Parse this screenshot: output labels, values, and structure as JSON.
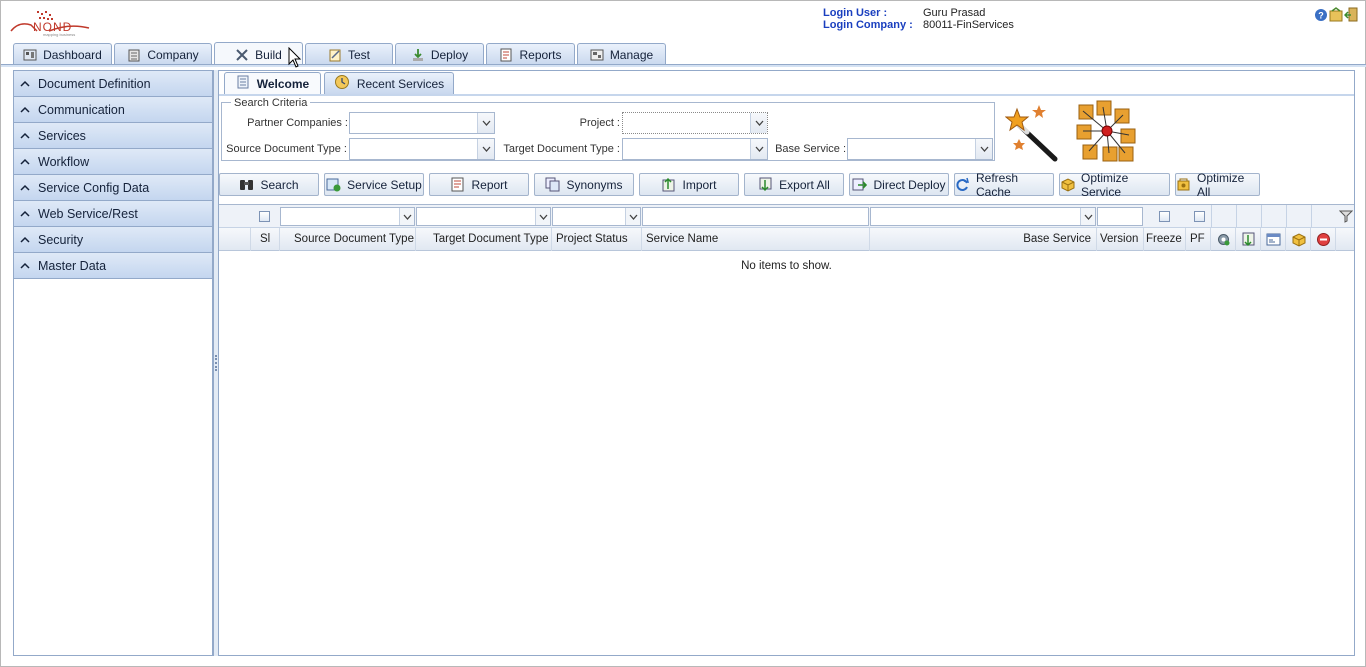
{
  "header": {
    "logo_text": "NOND",
    "logo_tagline": "mapping business",
    "login_user_label": "Login User :",
    "login_user_value": "Guru Prasad",
    "login_company_label": "Login Company :",
    "login_company_value": "80011-FinServices",
    "icons": [
      "help-icon",
      "user-settings-icon",
      "logout-icon"
    ]
  },
  "main_tabs": [
    {
      "label": "Dashboard",
      "icon": "dashboard-icon"
    },
    {
      "label": "Company",
      "icon": "company-icon"
    },
    {
      "label": "Build",
      "icon": "build-tools-icon",
      "active": true
    },
    {
      "label": "Test",
      "icon": "test-icon"
    },
    {
      "label": "Deploy",
      "icon": "deploy-icon"
    },
    {
      "label": "Reports",
      "icon": "reports-icon"
    },
    {
      "label": "Manage",
      "icon": "manage-icon"
    }
  ],
  "left_nav": [
    {
      "label": "Document Definition"
    },
    {
      "label": "Communication"
    },
    {
      "label": "Services"
    },
    {
      "label": "Workflow"
    },
    {
      "label": "Service Config Data"
    },
    {
      "label": "Web Service/Rest"
    },
    {
      "label": "Security"
    },
    {
      "label": "Master Data"
    }
  ],
  "sub_tabs": [
    {
      "label": "Welcome",
      "icon": "welcome-page-icon",
      "active": true
    },
    {
      "label": "Recent Services",
      "icon": "recent-services-icon"
    }
  ],
  "search_criteria": {
    "legend": "Search Criteria",
    "partner_companies_label": "Partner Companies :",
    "partner_companies_value": "",
    "project_label": "Project :",
    "project_value": "",
    "source_doc_type_label": "Source Document Type :",
    "source_doc_type_value": "",
    "target_doc_type_label": "Target Document Type :",
    "target_doc_type_value": "",
    "base_service_label": "Base Service :",
    "base_service_value": ""
  },
  "toolbar": [
    {
      "label": "Search",
      "icon": "binoculars-icon"
    },
    {
      "label": "Service Setup",
      "icon": "service-setup-icon"
    },
    {
      "label": "Report",
      "icon": "report-icon"
    },
    {
      "label": "Synonyms",
      "icon": "synonyms-icon"
    },
    {
      "label": "Import",
      "icon": "import-icon"
    },
    {
      "label": "Export All",
      "icon": "export-icon"
    },
    {
      "label": "Direct Deploy",
      "icon": "direct-deploy-icon"
    },
    {
      "label": "Refresh Cache",
      "icon": "refresh-icon"
    },
    {
      "label": "Optimize Service",
      "icon": "optimize-service-icon"
    },
    {
      "label": "Optimize All",
      "icon": "optimize-all-icon"
    }
  ],
  "grid": {
    "columns": [
      "Sl",
      "Source Document Type",
      "Target Document Type",
      "Project Status",
      "Service Name",
      "Base Service",
      "Version",
      "Freeze",
      "PF"
    ],
    "action_column_icons": [
      "settings-gear-icon",
      "export-row-icon",
      "form-view-icon",
      "package-icon",
      "delete-icon"
    ],
    "empty_text": "No items to show."
  },
  "colors": {
    "accent_blue": "#1a3fbf",
    "tab_border": "#93a9c9",
    "nav_bg": "#c4d6ef"
  }
}
